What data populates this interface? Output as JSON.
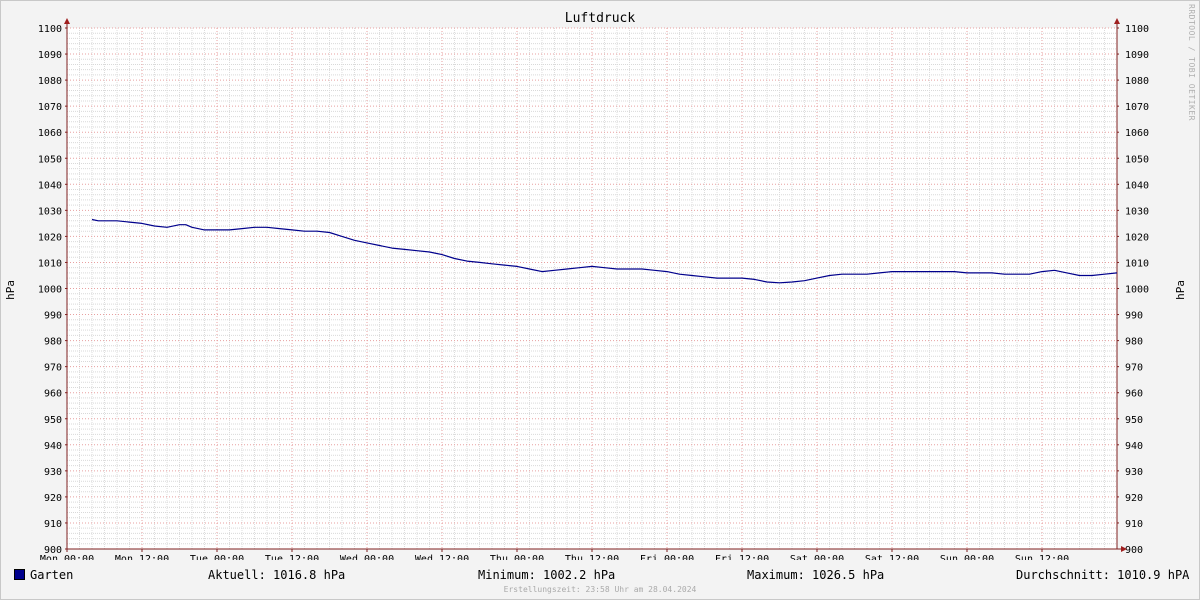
{
  "chart_data": {
    "type": "line",
    "title": "Luftdruck",
    "ylabel": "hPa",
    "ylim": [
      900,
      1100
    ],
    "yticks": [
      900,
      910,
      920,
      930,
      940,
      950,
      960,
      970,
      980,
      990,
      1000,
      1010,
      1020,
      1030,
      1040,
      1050,
      1060,
      1070,
      1080,
      1090,
      1100
    ],
    "x_tick_labels": [
      "Mon 00:00",
      "Mon 12:00",
      "Tue 00:00",
      "Tue 12:00",
      "Wed 00:00",
      "Wed 12:00",
      "Thu 00:00",
      "Thu 12:00",
      "Fri 00:00",
      "Fri 12:00",
      "Sat 00:00",
      "Sat 12:00",
      "Sun 00:00",
      "Sun 12:00"
    ],
    "x_unit": "hours since Mon 00:00",
    "xlim": [
      0,
      168
    ],
    "grid": true,
    "series": [
      {
        "name": "Garten",
        "color": "#00008c",
        "x": [
          4,
          5,
          8,
          10,
          12,
          14,
          16,
          18,
          19,
          20,
          22,
          24,
          26,
          28,
          30,
          32,
          34,
          36,
          38,
          40,
          42,
          44,
          46,
          48,
          50,
          52,
          54,
          56,
          58,
          60,
          62,
          64,
          66,
          68,
          70,
          72,
          74,
          76,
          78,
          80,
          82,
          84,
          86,
          88,
          90,
          92,
          94,
          96,
          98,
          100,
          102,
          104,
          106,
          108,
          110,
          112,
          114,
          116,
          118,
          120,
          122,
          124,
          126,
          128,
          130,
          132,
          134,
          136,
          138,
          140,
          142,
          144,
          146,
          148,
          150,
          152,
          154,
          156,
          158,
          160,
          162,
          164,
          166,
          168
        ],
        "values": [
          1026.5,
          1026.0,
          1026.0,
          1025.5,
          1025.0,
          1024.0,
          1023.5,
          1024.5,
          1024.5,
          1023.5,
          1022.5,
          1022.5,
          1022.5,
          1023.0,
          1023.5,
          1023.5,
          1023.0,
          1022.5,
          1022.0,
          1022.0,
          1021.5,
          1020.0,
          1018.5,
          1017.5,
          1016.5,
          1015.5,
          1015.0,
          1014.5,
          1014.0,
          1013.0,
          1011.5,
          1010.5,
          1010.0,
          1009.5,
          1009.0,
          1008.5,
          1007.5,
          1006.5,
          1007.0,
          1007.5,
          1008.0,
          1008.5,
          1008.0,
          1007.5,
          1007.5,
          1007.5,
          1007.0,
          1006.5,
          1005.5,
          1005.0,
          1004.5,
          1004.0,
          1004.0,
          1004.0,
          1003.5,
          1002.5,
          1002.2,
          1002.5,
          1003.0,
          1004.0,
          1005.0,
          1005.5,
          1005.5,
          1005.5,
          1006.0,
          1006.5,
          1006.5,
          1006.5,
          1006.5,
          1006.5,
          1006.5,
          1006.0,
          1006.0,
          1006.0,
          1005.5,
          1005.5,
          1005.5,
          1006.5,
          1007.0,
          1006.0,
          1005.0,
          1005.0,
          1005.5,
          1006.0
        ]
      }
    ],
    "legend": {
      "series_label": "Garten",
      "aktuell": "Aktuell: 1016.8 hPa",
      "minimum": "Minimum: 1002.2 hPa",
      "maximum": "Maximum: 1026.5 hPa",
      "durchschnitt": "Durchschnitt: 1010.9 hPA"
    },
    "watermark": "RRDTOOL / TOBI OETIKER",
    "footer": "Erstellungszeit: 23:58 Uhr am 28.04.2024"
  }
}
